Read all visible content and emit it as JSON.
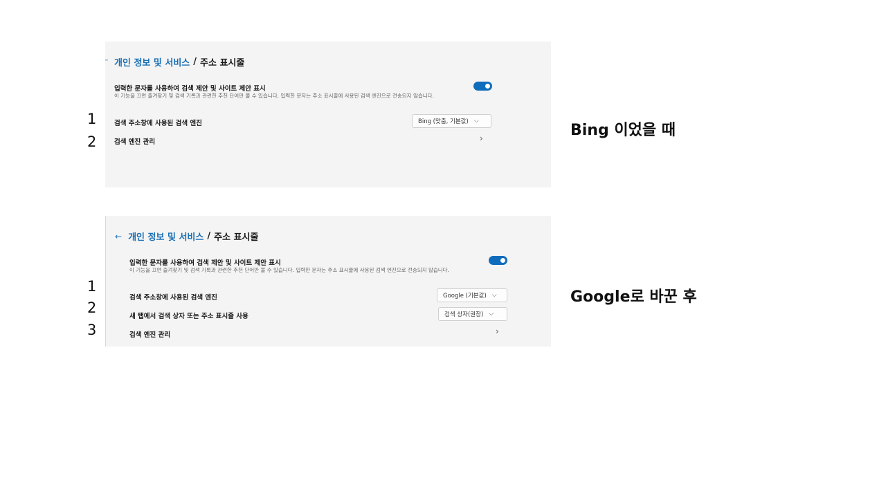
{
  "before": {
    "breadcrumb": {
      "link": "개인 정보 및 서비스",
      "separator": "/",
      "current": "주소 표시줄"
    },
    "suggestions": {
      "title": "입력한 문자를 사용하여 검색 제안 및 사이트 제안 표시",
      "description": "이 기능을 끄면 즐겨찾기 및 검색 기록과 관련한 추천 단어만 볼 수 있습니다. 입력한 문자는 주소 표시줄에 사용된 검색 엔진으로 전송되지 않습니다.",
      "enabled": true
    },
    "search_engine": {
      "label": "검색 주소창에 사용된 검색 엔진",
      "selected": "Bing (맞춤, 기본값)"
    },
    "manage": {
      "label": "검색 엔진 관리"
    },
    "row_numbers": [
      "1",
      "2"
    ],
    "caption": "Bing 이었을 때"
  },
  "after": {
    "breadcrumb": {
      "link": "개인 정보 및 서비스",
      "separator": "/",
      "current": "주소 표시줄"
    },
    "suggestions": {
      "title": "입력한 문자를 사용하여 검색 제안 및 사이트 제안 표시",
      "description": "이 기능을 끄면 즐겨찾기 및 검색 기록과 관련한 추천 단어만 볼 수 있습니다. 입력한 문자는 주소 표시줄에 사용된 검색 엔진으로 전송되지 않습니다.",
      "enabled": true
    },
    "search_engine": {
      "label": "검색 주소창에 사용된 검색 엔진",
      "selected": "Google (기본값)"
    },
    "new_tab": {
      "label": "새 탭에서 검색 상자 또는 주소 표시줄 사용",
      "selected": "검색 상자(권장)"
    },
    "manage": {
      "label": "검색 엔진 관리"
    },
    "row_numbers": [
      "1",
      "2",
      "3"
    ],
    "caption": "Google로 바꾼 후"
  },
  "colors": {
    "accent": "#0f6cbd",
    "link": "#1a6fb5",
    "panel_bg": "#f4f4f4"
  },
  "icons": {
    "back": "arrow-left-icon",
    "dropdown": "chevron-down-icon",
    "navigate": "chevron-right-icon"
  }
}
